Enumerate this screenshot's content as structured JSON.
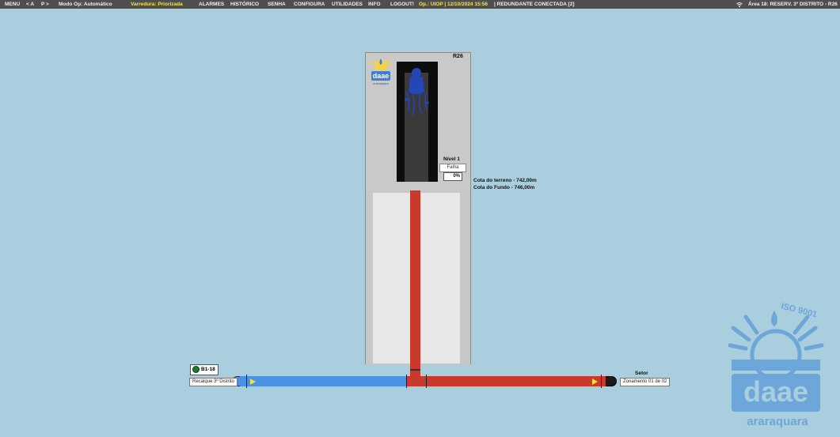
{
  "topbar": {
    "menu": "MENU",
    "prev": "< A",
    "next": "P >",
    "mode": "Modo Op: Automático",
    "scan": "Varredura: Priorizada",
    "alarms": "ALARMES",
    "history": "HISTÓRICO",
    "password": "SENHA",
    "config": "CONFIGURA",
    "utilities": "UTILIDADES",
    "info": "INFO",
    "logout": "LOGOUT!",
    "operator": "Op.: UIOP | 12/10/2024  15:56",
    "redundancy": "| REDUNDANTE CONECTADA [2]",
    "area": "Área 18: RESERV. 3º DISTRITO - R26",
    "accent_color": "#f3e25a",
    "bar_color": "#4e4e4e"
  },
  "tank": {
    "id": "R26",
    "logo_text": "daae",
    "logo_subtext": "araraquara",
    "level_label": "Nível 1",
    "level_status": "Falha",
    "level_value": "0%",
    "level_fraction": 0,
    "cota_terreno": "Cota do terreno - 742,00m",
    "cota_fundo": "Cota do Fundo  - 746,00m"
  },
  "pipeline": {
    "inlet_color": "#4a90e3",
    "outlet_color": "#c93a2c",
    "status_badge": "B1-18",
    "status_color": "#1f7a2a",
    "inlet_label": "Recalque 3º Distrito",
    "outlet_title": "Setor",
    "outlet_label": "Zonamento 01 de 02"
  },
  "watermark": {
    "iso": "ISO 9001",
    "brand": "daae",
    "city": "araraquara"
  }
}
